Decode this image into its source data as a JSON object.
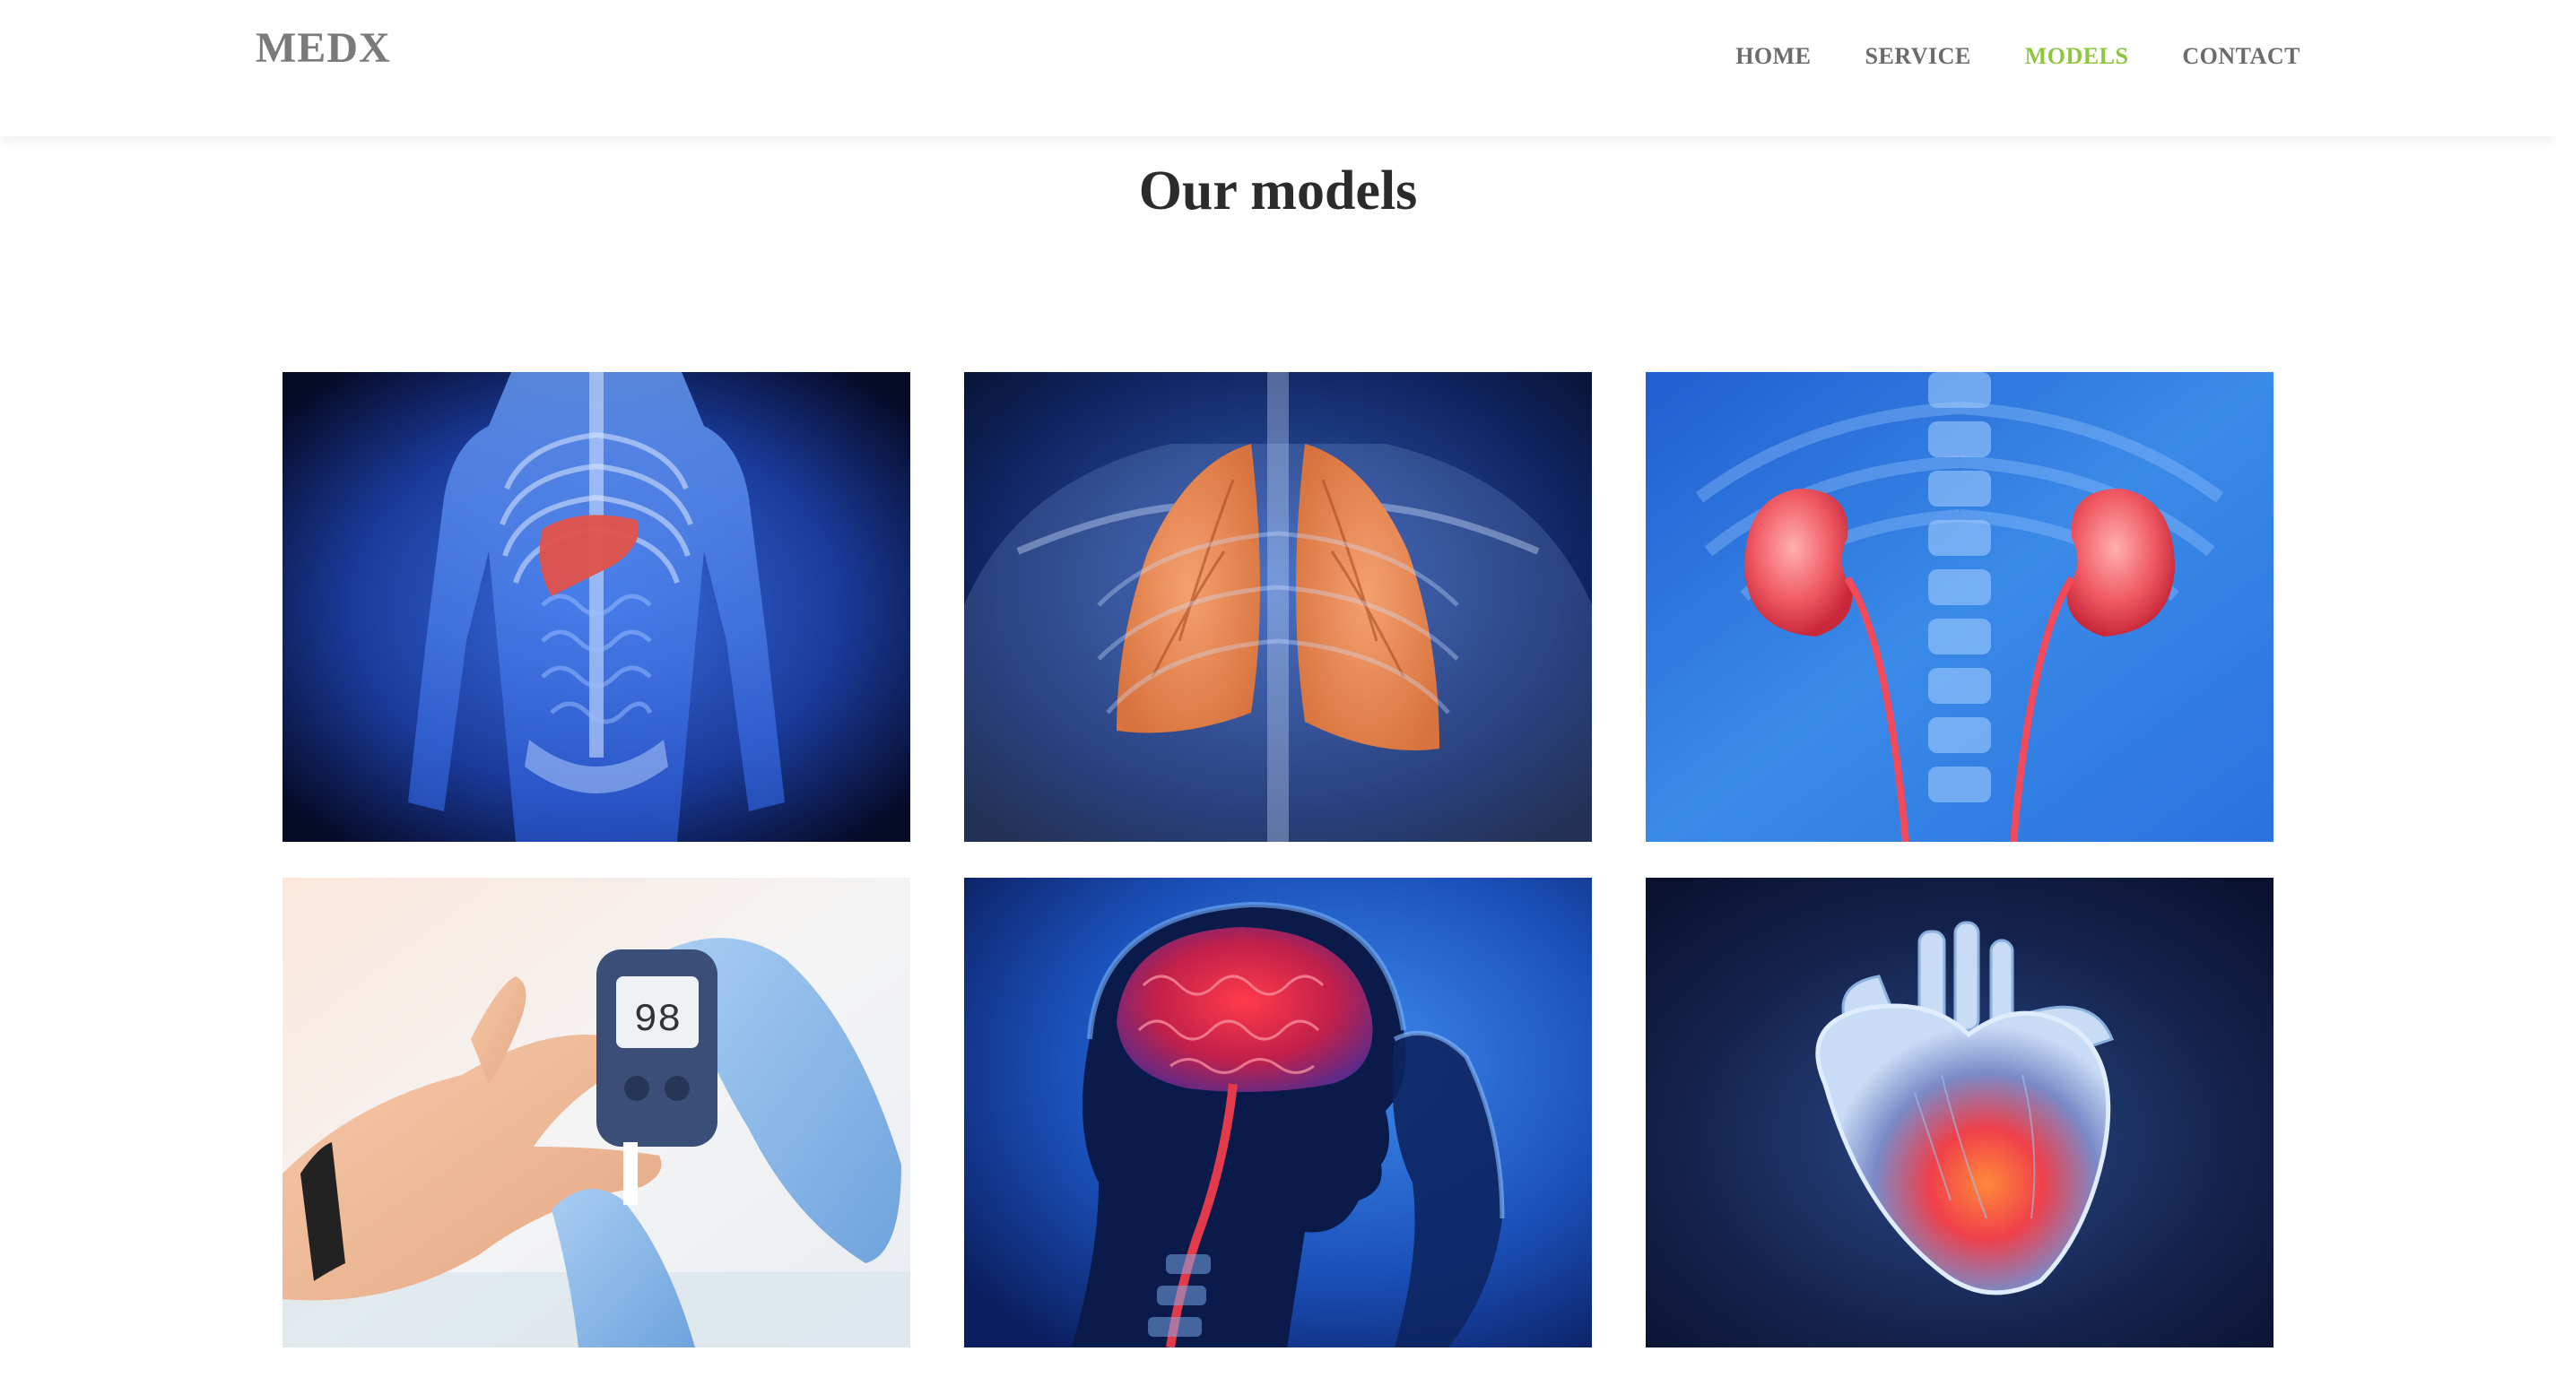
{
  "header": {
    "logo": "MEDX",
    "nav": [
      {
        "label": "HOME",
        "active": false
      },
      {
        "label": "SERVICE",
        "active": false
      },
      {
        "label": "MODELS",
        "active": true
      },
      {
        "label": "CONTACT",
        "active": false
      }
    ],
    "active_color": "#8dc63f"
  },
  "main": {
    "title": "Our models",
    "models": [
      {
        "subject": "liver",
        "icon": "liver-illustration"
      },
      {
        "subject": "lungs",
        "icon": "lungs-illustration"
      },
      {
        "subject": "kidneys",
        "icon": "kidneys-illustration"
      },
      {
        "subject": "diabetes",
        "icon": "glucose-meter-illustration",
        "meter_reading": "98"
      },
      {
        "subject": "brain",
        "icon": "brain-illustration"
      },
      {
        "subject": "heart",
        "icon": "heart-illustration"
      }
    ]
  }
}
